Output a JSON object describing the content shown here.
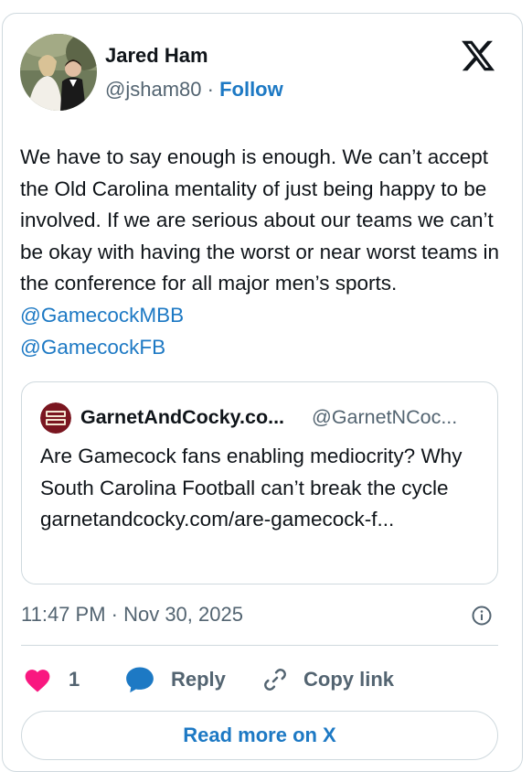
{
  "author": {
    "name": "Jared Ham",
    "handle": "@jsham80",
    "separator": "·",
    "follow_label": "Follow"
  },
  "tweet": {
    "text": "We have to say enough is enough. We can’t accept the Old Carolina mentality of just being happy to be involved. If we are serious about our teams we can’t be okay with having the worst or near worst teams in the conference for all major men’s sports.",
    "mentions": [
      "@GamecockMBB",
      "@GamecockFB"
    ]
  },
  "quote": {
    "name": "GarnetAndCocky.co...",
    "handle": "@GarnetNCoc...",
    "text": "Are Gamecock fans enabling mediocrity? Why South Carolina Football can’t break the cycle garnetandcocky.com/are-gamecock-f..."
  },
  "timestamp": "11:47 PM · Nov 30, 2025",
  "actions": {
    "like_count": "1",
    "reply_label": "Reply",
    "copy_label": "Copy link"
  },
  "read_more_label": "Read more on X",
  "colors": {
    "accent": "#1d79c4",
    "like": "#f91880",
    "border": "#cfd9de",
    "muted": "#536471",
    "text": "#0f1419"
  }
}
